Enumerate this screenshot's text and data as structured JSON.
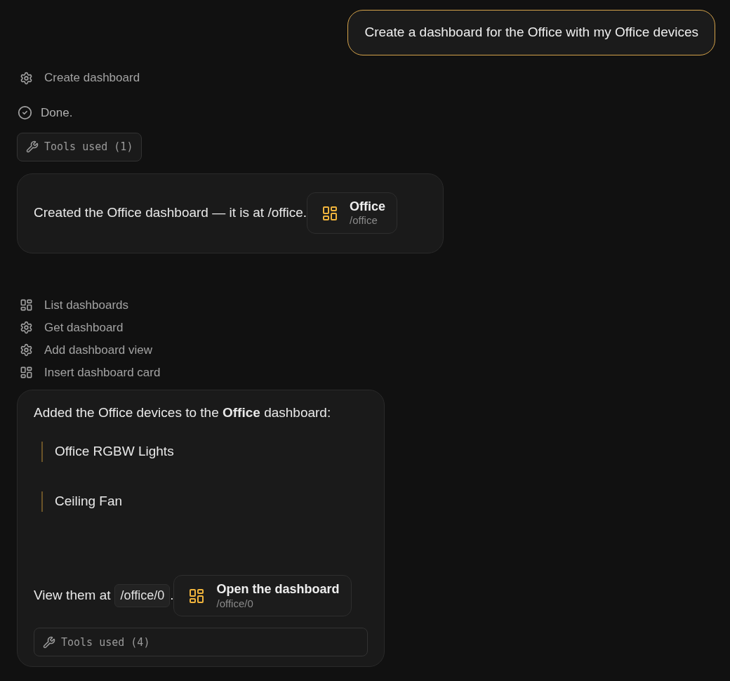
{
  "user_message": "Create a dashboard for the Office with my Office devices",
  "first_reply": {
    "steps": [
      {
        "kind": "gear",
        "label": "Create dashboard"
      }
    ],
    "status": "Done.",
    "tools_button": "Tools used (1)",
    "text": "Created the Office dashboard — it is at /office.",
    "link": {
      "title": "Office",
      "path": "/office"
    }
  },
  "second_reply": {
    "steps": [
      {
        "kind": "dashboard",
        "label": "List dashboards"
      },
      {
        "kind": "gear",
        "label": "Get dashboard"
      },
      {
        "kind": "gear",
        "label": "Add dashboard view"
      },
      {
        "kind": "dashboard",
        "label": "Insert dashboard card"
      }
    ],
    "intro": "Added the Office devices to the **Office** dashboard:",
    "devices": [
      "Office RGBW Lights",
      "Ceiling Fan"
    ],
    "view_text": "View them at",
    "code": "/office/0",
    "period": ".",
    "link": {
      "title": "Open the dashboard",
      "path": "/office/0"
    },
    "tools_button": "Tools used (4)"
  }
}
